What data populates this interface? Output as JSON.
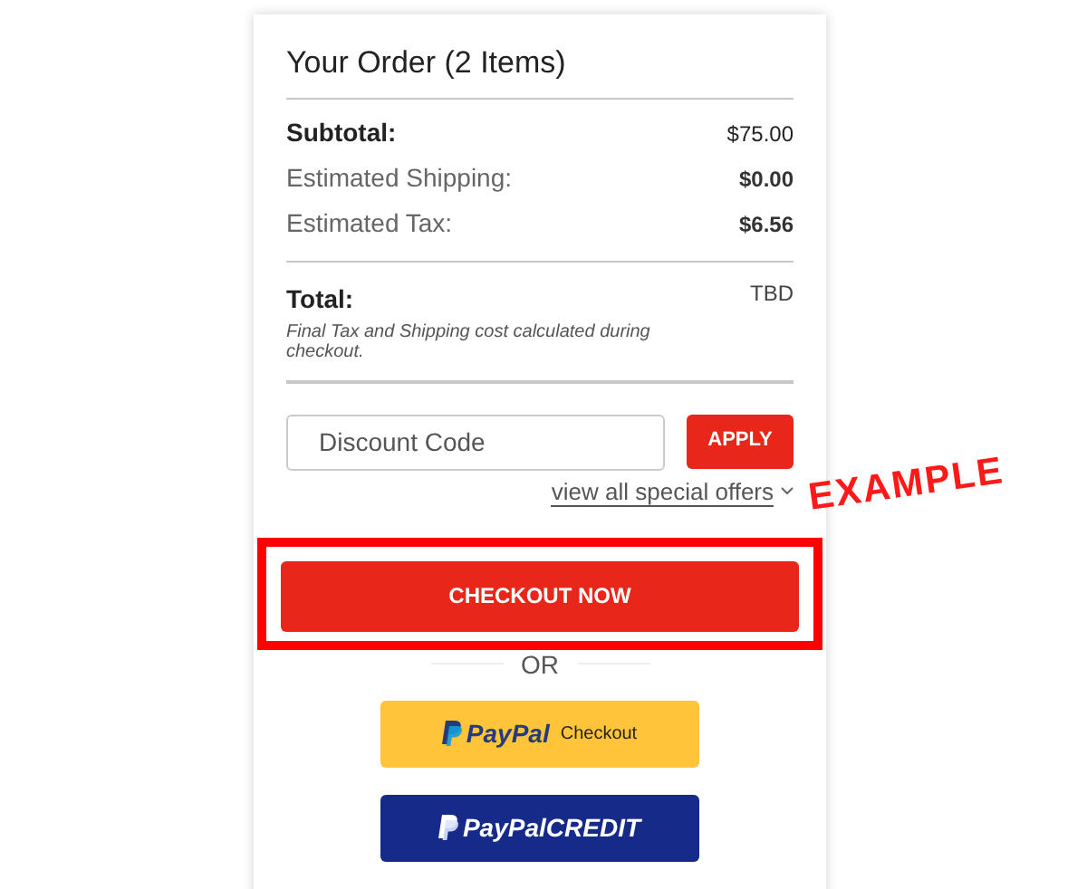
{
  "order": {
    "title": "Your Order (2 Items)",
    "lines": [
      {
        "label": "Subtotal:",
        "value": "$75.00",
        "kind": "bold"
      },
      {
        "label": "Estimated Shipping:",
        "value": "$0.00",
        "kind": "plain"
      },
      {
        "label": "Estimated Tax:",
        "value": "$6.56",
        "kind": "plain"
      }
    ],
    "total": {
      "label": "Total:",
      "value": "TBD"
    },
    "note": "Final Tax and Shipping cost calculated during checkout.",
    "discount": {
      "placeholder": "Discount Code",
      "button": "APPLY"
    },
    "offers_link": "view all special offers",
    "checkout_button": "CHECKOUT NOW",
    "separator": "OR",
    "paypal": {
      "brand": "PayPal",
      "label": "Checkout"
    },
    "paypal_credit": {
      "brand": "PayPal",
      "label": "CREDIT"
    }
  },
  "annotation": {
    "stamp": "EXAMPLE",
    "highlight": true
  }
}
